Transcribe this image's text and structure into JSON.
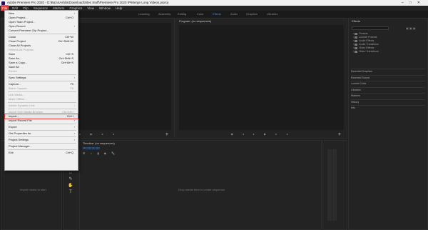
{
  "titlebar": {
    "title": "Adobe Premiere Pro 2020 - D:\\Bazu\\Ashila\\Download\\Sites Stuff\\Premiere Pro 2020 \\P\\Merge Long Videos.prproj"
  },
  "menubar": {
    "items": [
      "File",
      "Edit",
      "Clip",
      "Sequence",
      "Markers",
      "Graphics",
      "View",
      "Window",
      "Help"
    ]
  },
  "workspaces": [
    "Learning",
    "Assembly",
    "Editing",
    "Color",
    "Effects",
    "Audio",
    "Graphics",
    "Libraries"
  ],
  "panels": {
    "program_title": "Program: (no sequences)",
    "effects_title": "Effects",
    "timeline_title": "Timeline: (no sequences)",
    "timeline_timecode": "00;00;00;00",
    "timeline_hint": "Drop media here to create sequence.",
    "project_hint": "Import media to start"
  },
  "effects": {
    "folders": [
      "Presets",
      "Lumetri Presets",
      "Audio Effects",
      "Audio Transitions",
      "Video Effects",
      "Video Transitions"
    ],
    "sections": [
      "Essential Graphics",
      "Essential Sound",
      "Lumetri Color",
      "Libraries",
      "Markers",
      "History",
      "Info"
    ]
  },
  "file_menu": [
    {
      "label": "New",
      "arrow": true
    },
    {
      "label": "Open Project...",
      "shortcut": "Ctrl+O"
    },
    {
      "label": "Open Team Project..."
    },
    {
      "label": "Open Recent",
      "arrow": true
    },
    {
      "label": "Convert Premiere Clip Project..."
    },
    {
      "sep": true
    },
    {
      "label": "Close",
      "shortcut": "Ctrl+W"
    },
    {
      "label": "Close Project",
      "shortcut": "Ctrl+Shift+W"
    },
    {
      "label": "Close All Projects"
    },
    {
      "label": "Refresh All Projects",
      "disabled": true
    },
    {
      "label": "Save",
      "shortcut": "Ctrl+S"
    },
    {
      "label": "Save As...",
      "shortcut": "Ctrl+Shift+S"
    },
    {
      "label": "Save a Copy...",
      "shortcut": "Ctrl+Alt+S"
    },
    {
      "label": "Save All"
    },
    {
      "label": "Revert",
      "disabled": true
    },
    {
      "sep": true
    },
    {
      "label": "Sync Settings",
      "arrow": true
    },
    {
      "sep": true
    },
    {
      "label": "Capture...",
      "shortcut": "F5"
    },
    {
      "label": "Batch Capture...",
      "shortcut": "F6",
      "disabled": true
    },
    {
      "sep": true
    },
    {
      "label": "Link Media...",
      "disabled": true
    },
    {
      "label": "Make Offline...",
      "disabled": true
    },
    {
      "sep": true
    },
    {
      "label": "Adobe Dynamic Link",
      "arrow": true,
      "disabled": true
    },
    {
      "sep": true
    },
    {
      "label": "Import from Media Browser",
      "shortcut": "Ctrl+Alt+I",
      "disabled": true
    },
    {
      "label": "Import...",
      "shortcut": "Ctrl+I",
      "highlight": true
    },
    {
      "label": "Import Recent File",
      "arrow": true
    },
    {
      "sep": true
    },
    {
      "label": "Export",
      "arrow": true
    },
    {
      "sep": true
    },
    {
      "label": "Get Properties for",
      "arrow": true
    },
    {
      "sep": true
    },
    {
      "label": "Project Settings",
      "arrow": true
    },
    {
      "sep": true
    },
    {
      "label": "Project Manager..."
    },
    {
      "sep": true
    },
    {
      "label": "Exit",
      "shortcut": "Ctrl+Q"
    }
  ]
}
